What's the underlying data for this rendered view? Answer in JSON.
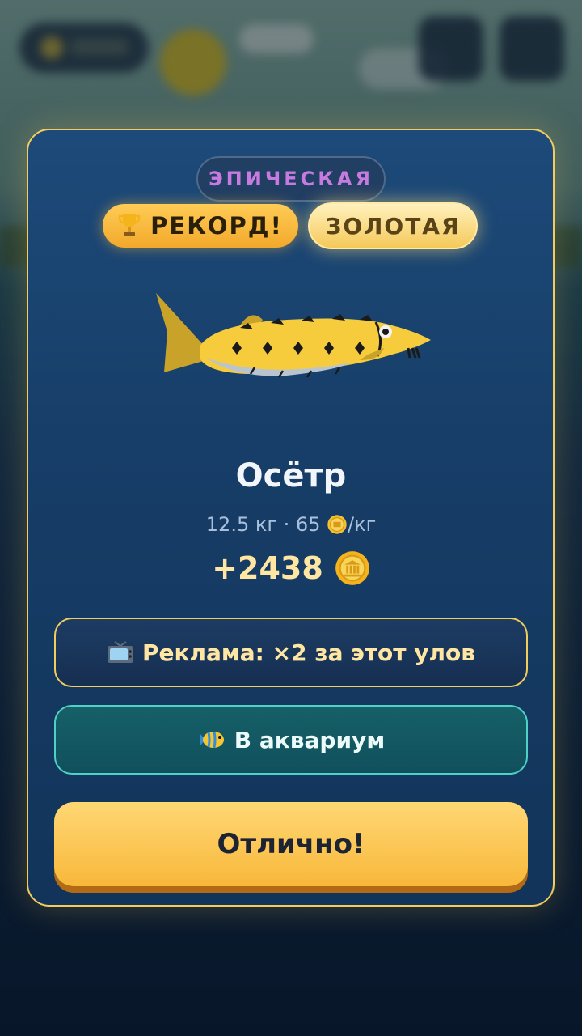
{
  "popup": {
    "rarity_label": "ЭПИЧЕСКАЯ",
    "record_label": "РЕКОРД!",
    "gold_label": "ЗОЛОТАЯ",
    "fish_name": "Осётр",
    "stats_prefix": "12.5 кг · 65 ",
    "stats_suffix": "/кг",
    "reward_value": "+2438",
    "ad_button_label": "Реклама: ×2 за этот улов",
    "aquarium_button_label": "В аквариум",
    "ok_button_label": "Отлично!"
  },
  "colors": {
    "accent_gold": "#f2cd5d",
    "rarity_epic": "#c77be0",
    "aquarium_teal": "#4fd1c5"
  }
}
